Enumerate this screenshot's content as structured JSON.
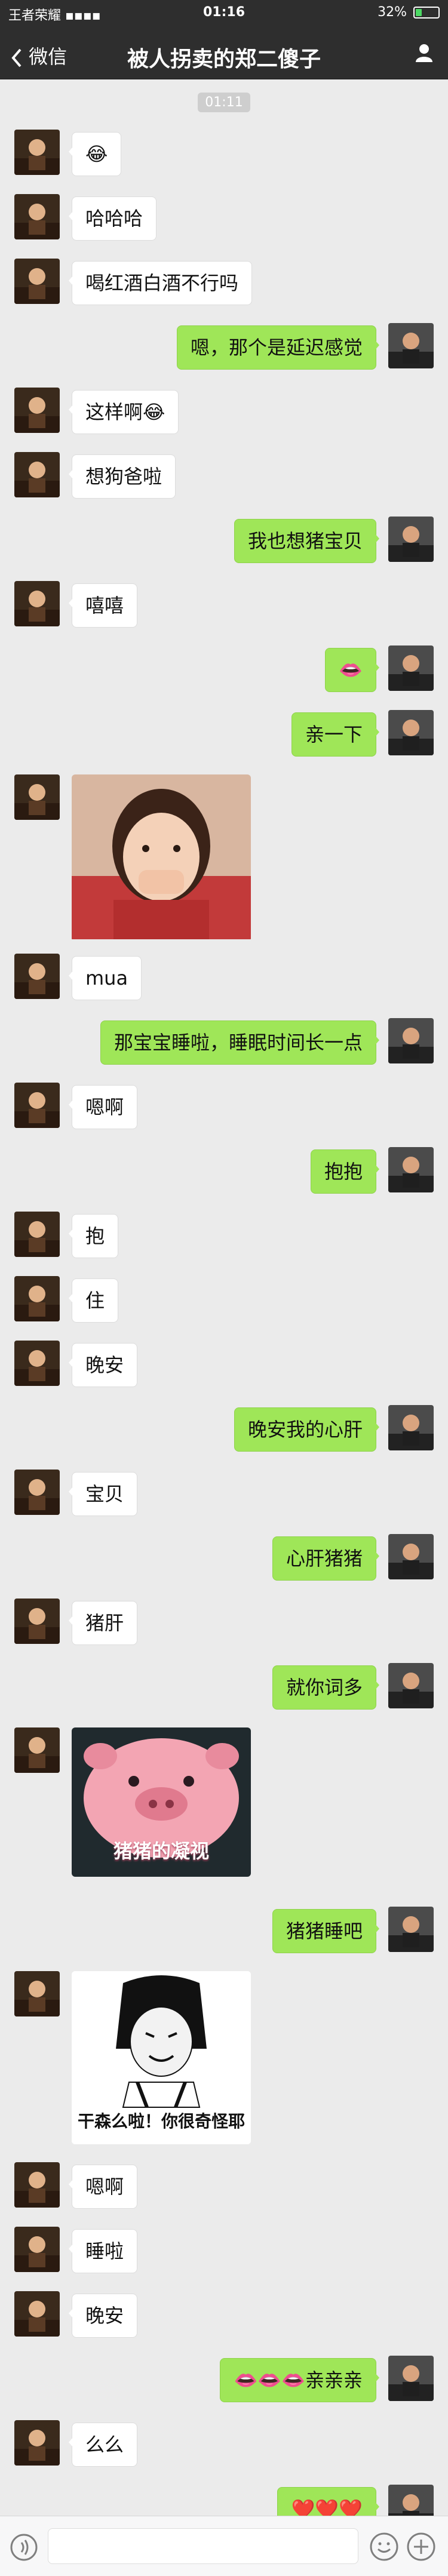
{
  "status_bar": {
    "carrier": "王者荣耀 ▪▪▪▪",
    "time": "01:16",
    "battery": "32%"
  },
  "nav": {
    "back_label": "微信",
    "title": "被人拐卖的郑二傻子"
  },
  "timestamp": "01:11",
  "messages": [
    {
      "side": "left",
      "kind": "emoji",
      "text": "😂"
    },
    {
      "side": "left",
      "kind": "text",
      "text": "哈哈哈"
    },
    {
      "side": "left",
      "kind": "text",
      "text": "喝红酒白酒不行吗"
    },
    {
      "side": "right",
      "kind": "text",
      "text": "嗯，那个是延迟感觉"
    },
    {
      "side": "left",
      "kind": "text",
      "text": "这样啊😂"
    },
    {
      "side": "left",
      "kind": "text",
      "text": "想狗爸啦"
    },
    {
      "side": "right",
      "kind": "text",
      "text": "我也想猪宝贝"
    },
    {
      "side": "left",
      "kind": "text",
      "text": "嘻嘻"
    },
    {
      "side": "right",
      "kind": "emoji",
      "text": "👄"
    },
    {
      "side": "right",
      "kind": "text",
      "text": "亲一下"
    },
    {
      "side": "left",
      "kind": "photo",
      "text": ""
    },
    {
      "side": "left",
      "kind": "text",
      "text": "mua"
    },
    {
      "side": "right",
      "kind": "text",
      "text": "那宝宝睡啦，睡眠时间长一点"
    },
    {
      "side": "left",
      "kind": "text",
      "text": "嗯啊"
    },
    {
      "side": "right",
      "kind": "text",
      "text": "抱抱"
    },
    {
      "side": "left",
      "kind": "text",
      "text": "抱"
    },
    {
      "side": "left",
      "kind": "text",
      "text": "住"
    },
    {
      "side": "left",
      "kind": "text",
      "text": "晚安"
    },
    {
      "side": "right",
      "kind": "text",
      "text": "晚安我的心肝"
    },
    {
      "side": "left",
      "kind": "text",
      "text": "宝贝"
    },
    {
      "side": "right",
      "kind": "text",
      "text": "心肝猪猪"
    },
    {
      "side": "left",
      "kind": "text",
      "text": "猪肝"
    },
    {
      "side": "right",
      "kind": "text",
      "text": "就你词多"
    },
    {
      "side": "left",
      "kind": "sticker_pig",
      "text": "猪猪的凝视"
    },
    {
      "side": "right",
      "kind": "text",
      "text": "猪猪睡吧"
    },
    {
      "side": "left",
      "kind": "sticker_meme",
      "text": "干森么啦！你很奇怪耶"
    },
    {
      "side": "left",
      "kind": "text",
      "text": "嗯啊"
    },
    {
      "side": "left",
      "kind": "text",
      "text": "睡啦"
    },
    {
      "side": "left",
      "kind": "text",
      "text": "晚安"
    },
    {
      "side": "right",
      "kind": "text",
      "text": "👄👄👄亲亲亲"
    },
    {
      "side": "left",
      "kind": "text",
      "text": "么么"
    },
    {
      "side": "right",
      "kind": "text",
      "text": "❤️❤️❤️"
    }
  ]
}
